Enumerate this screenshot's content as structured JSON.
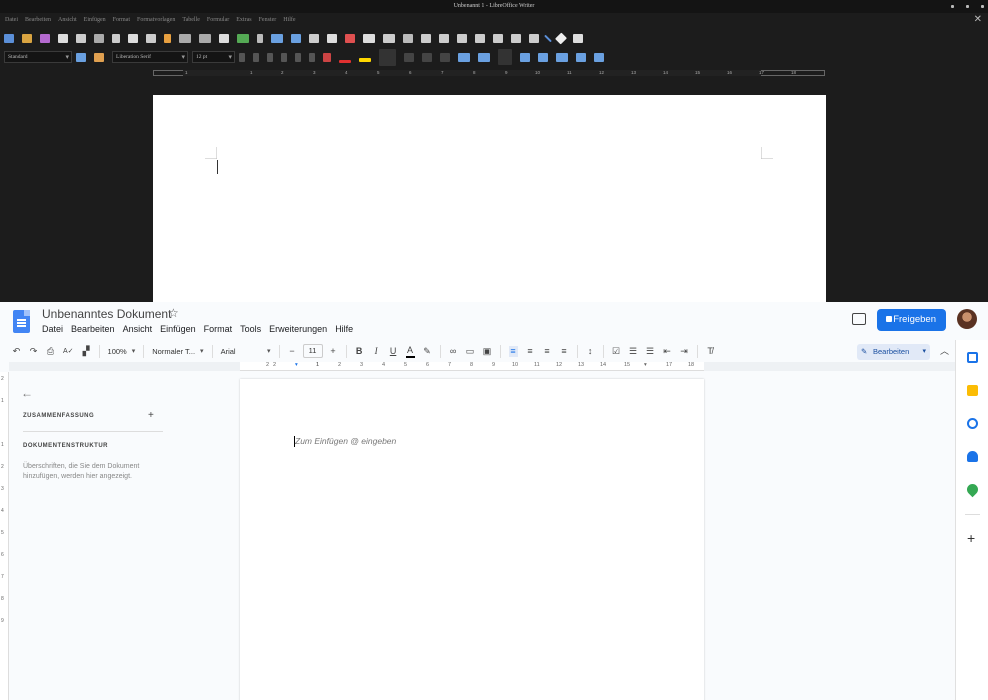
{
  "libreoffice": {
    "window_title": "Unbenannt 1 - LibreOffice Writer",
    "menu": [
      "Datei",
      "Bearbeiten",
      "Ansicht",
      "Einfügen",
      "Format",
      "Formatvorlagen",
      "Tabelle",
      "Formular",
      "Extras",
      "Fenster",
      "Hilfe"
    ],
    "close_icon": "close-icon",
    "paragraph_style": "Standard",
    "font_name": "Liberation Serif",
    "font_size": "12 pt",
    "ruler_ticks": [
      "1",
      "1",
      "2",
      "3",
      "4",
      "5",
      "6",
      "7",
      "8",
      "9",
      "10",
      "11",
      "12",
      "13",
      "14",
      "15",
      "16",
      "17",
      "18"
    ],
    "colors": {
      "background": "#1c1c1c",
      "titlebar": "#141414",
      "page": "#ffffff",
      "font_color_bar": "#e03030",
      "highlight_bar": "#ffd700"
    }
  },
  "gdocs": {
    "doc_title": "Unbenanntes Dokument",
    "menu": [
      "Datei",
      "Bearbeiten",
      "Ansicht",
      "Einfügen",
      "Format",
      "Tools",
      "Erweiterungen",
      "Hilfe"
    ],
    "share_label": "Freigeben",
    "zoom": "100%",
    "style": "Normaler T...",
    "font": "Arial",
    "font_size": "11",
    "mode": "Bearbeiten",
    "ruler_ticks": [
      "2",
      "1",
      "1",
      "2",
      "3",
      "4",
      "5",
      "6",
      "7",
      "8",
      "9",
      "10",
      "11",
      "12",
      "13",
      "14",
      "15",
      "17",
      "18"
    ],
    "vruler_ticks": [
      "2",
      "1",
      "1",
      "2",
      "3",
      "4",
      "5",
      "6",
      "7",
      "8",
      "9"
    ],
    "outline": {
      "summary_label": "ZUSAMMENFASSUNG",
      "structure_label": "DOKUMENTENSTRUKTUR",
      "hint": "Überschriften, die Sie dem Dokument hinzufügen, werden hier angezeigt."
    },
    "placeholder": "Zum Einfügen @ eingeben",
    "colors": {
      "accent": "#1a73e8",
      "calendar": "#1a73e8",
      "keep": "#fbbc04",
      "tasks": "#1a73e8",
      "contacts": "#1a73e8",
      "maps": "#34a853"
    }
  }
}
